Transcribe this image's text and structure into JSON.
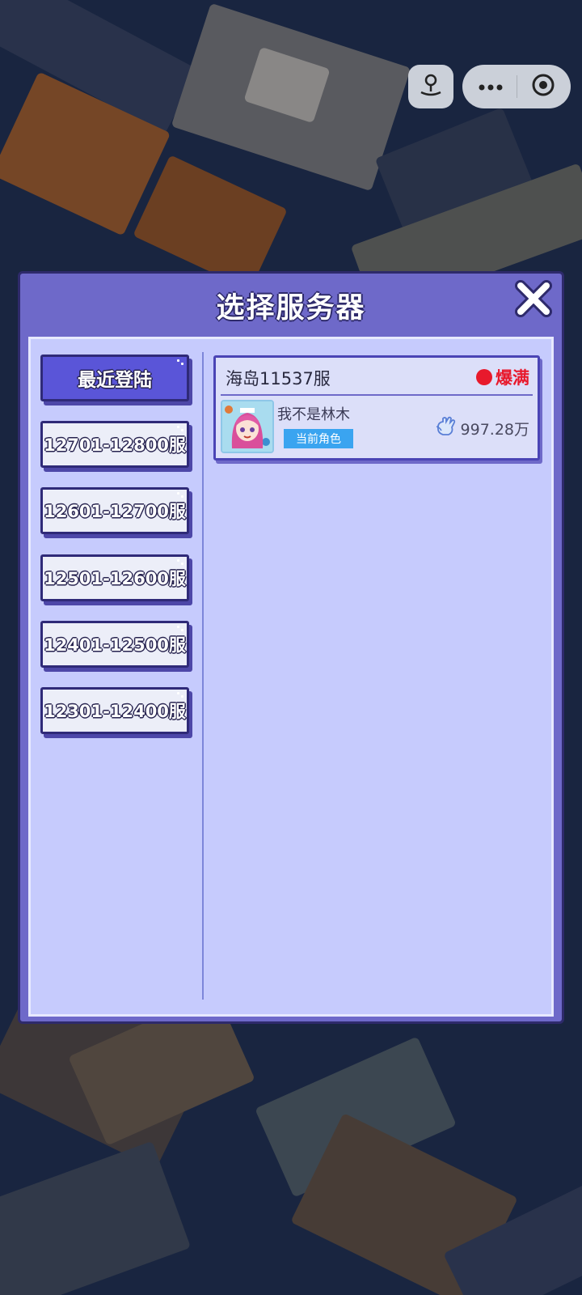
{
  "dialog": {
    "title": "选择服务器",
    "close_label": "关闭"
  },
  "ranges": {
    "items": [
      {
        "label": "最近登陆",
        "active": true
      },
      {
        "label": "12701-12800服",
        "active": false
      },
      {
        "label": "12601-12700服",
        "active": false
      },
      {
        "label": "12501-12600服",
        "active": false
      },
      {
        "label": "12401-12500服",
        "active": false
      },
      {
        "label": "12301-12400服",
        "active": false
      }
    ]
  },
  "server_card": {
    "name": "海岛11537服",
    "status": "爆满",
    "status_color": "#e8192c",
    "role_name": "我不是林木",
    "role_badge": "当前角色",
    "power": "997.28万"
  },
  "icons": {
    "capsule_left": "joystick-icon",
    "capsule_menu": "more-dots-icon",
    "capsule_close": "target-circle-icon",
    "close": "close-x-icon",
    "power": "fist-power-icon",
    "avatar": "character-avatar"
  },
  "colors": {
    "dialog_frame": "#6e69c9",
    "dialog_body": "#c6cbfd",
    "active_tab": "#5a55d8",
    "badge": "#3aa4f0"
  }
}
